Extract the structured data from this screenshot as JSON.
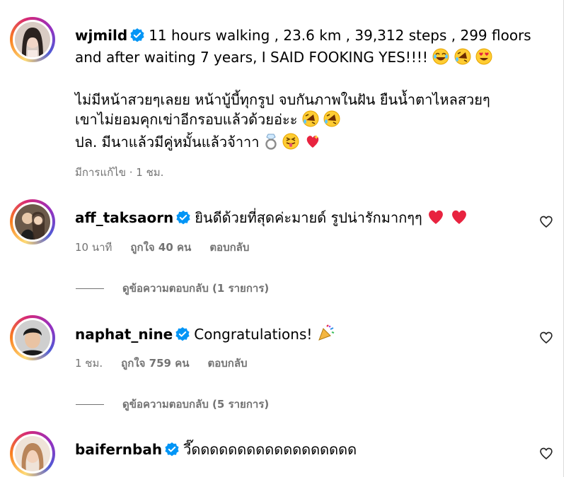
{
  "post": {
    "username": "wjmild",
    "caption_line1": "11 hours walking , 23.6 km , 39,312 steps , 299 floors",
    "caption_line2": "and after waiting 7 years, I SAID FOOKING YES!!!!",
    "caption_th1": "ไม่มีหน้าสวยๆเลยย หน้าบู้บี้ทุกรูป จบกันภาพในฝัน ยืนน้ำตาไหลสวยๆ",
    "caption_th2": "เขาไม่ยอมคุกเข่าอีกรอบแล้วด้วยอ่ะะ",
    "caption_th3": "ปล. มีนาแล้วมีคู่หมั้นแล้วจ้าาา",
    "meta": "มีการแก้ไข · 1 ชม."
  },
  "comments": [
    {
      "username": "aff_taksaorn",
      "text": "ยินดีด้วยที่สุดค่ะมายด์ รูปน่ารักมากๆๆ",
      "time": "10 นาที",
      "likes": "ถูกใจ 40 คน",
      "reply": "ตอบกลับ",
      "view_replies": "ดูข้อความตอบกลับ (1 รายการ)"
    },
    {
      "username": "naphat_nine",
      "text": "Congratulations!",
      "time": "1 ชม.",
      "likes": "ถูกใจ 759 คน",
      "reply": "ตอบกลับ",
      "view_replies": "ดูข้อความตอบกลับ (5 รายการ)"
    },
    {
      "username": "baifernbah",
      "text": "วี๊ดดดดดดดดดดดดดดดดดด"
    }
  ],
  "icons": {
    "verified": "verified-badge-icon",
    "heart": "heart-outline-icon"
  },
  "colors": {
    "verified_blue": "#0095f6",
    "meta_gray": "#737373"
  }
}
